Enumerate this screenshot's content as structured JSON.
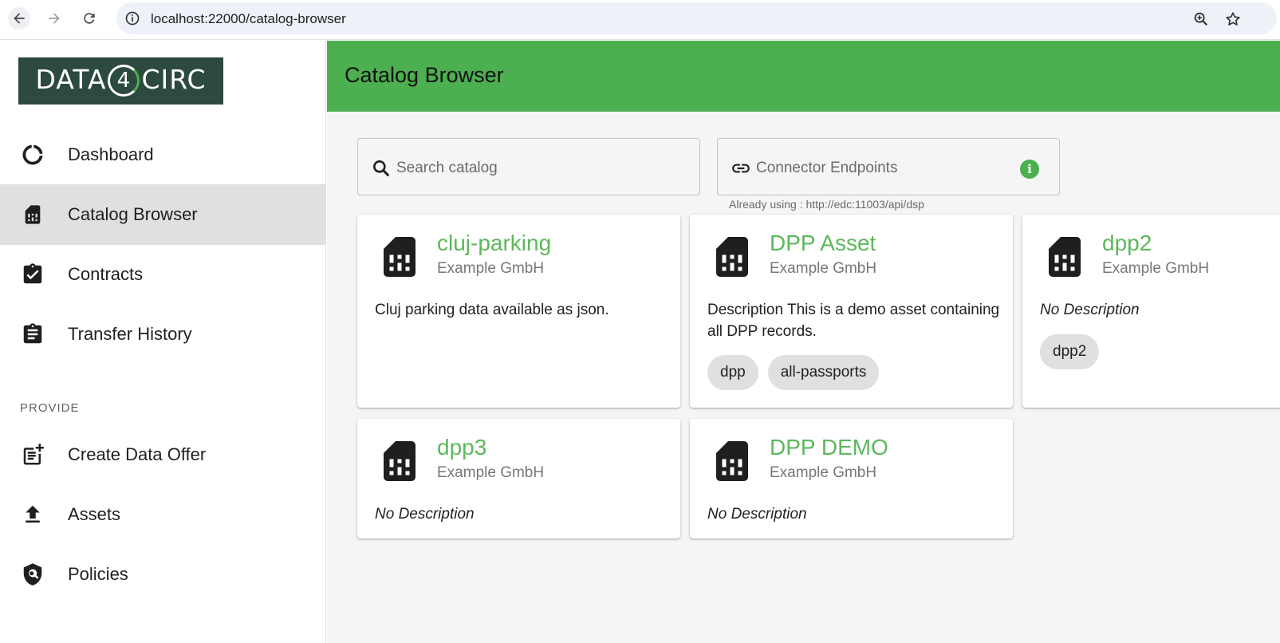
{
  "browser": {
    "url": "localhost:22000/catalog-browser",
    "icons": [
      "back-icon",
      "forward-icon",
      "reload-icon",
      "info-icon",
      "zoom-icon",
      "star-icon"
    ]
  },
  "sidebar": {
    "logo": {
      "left": "DATA",
      "four": "4",
      "right": "CIRC"
    },
    "items": [
      {
        "label": "Dashboard",
        "icon": "dashboard-icon"
      },
      {
        "label": "Catalog Browser",
        "icon": "catalog-icon",
        "active": true
      },
      {
        "label": "Contracts",
        "icon": "contracts-icon"
      },
      {
        "label": "Transfer History",
        "icon": "transfer-history-icon"
      }
    ],
    "section_provide": "PROVIDE",
    "provide_items": [
      {
        "label": "Create Data Offer",
        "icon": "create-offer-icon"
      },
      {
        "label": "Assets",
        "icon": "upload-icon"
      },
      {
        "label": "Policies",
        "icon": "policy-shield-icon"
      }
    ]
  },
  "header": {
    "title": "Catalog Browser"
  },
  "search": {
    "placeholder": "Search catalog"
  },
  "connector": {
    "label": "Connector Endpoints",
    "info": "i",
    "helper": "Already using : http://edc:11003/api/dsp"
  },
  "accent": "#4caf50",
  "cards": [
    {
      "title": "cluj-parking",
      "publisher": "Example GmbH",
      "description": "Cluj parking data available as json.",
      "tags": []
    },
    {
      "title": "DPP Asset",
      "publisher": "Example GmbH",
      "description": "Description This is a demo asset containing all DPP records.",
      "tags": [
        "dpp",
        "all-passports"
      ]
    },
    {
      "title": "dpp2",
      "publisher": "Example GmbH",
      "description": "No Description",
      "tags": [
        "dpp2"
      ]
    },
    {
      "title": "dpp3",
      "publisher": "Example GmbH",
      "description": "No Description",
      "tags": []
    },
    {
      "title": "DPP DEMO",
      "publisher": "Example GmbH",
      "description": "No Description",
      "tags": []
    }
  ]
}
